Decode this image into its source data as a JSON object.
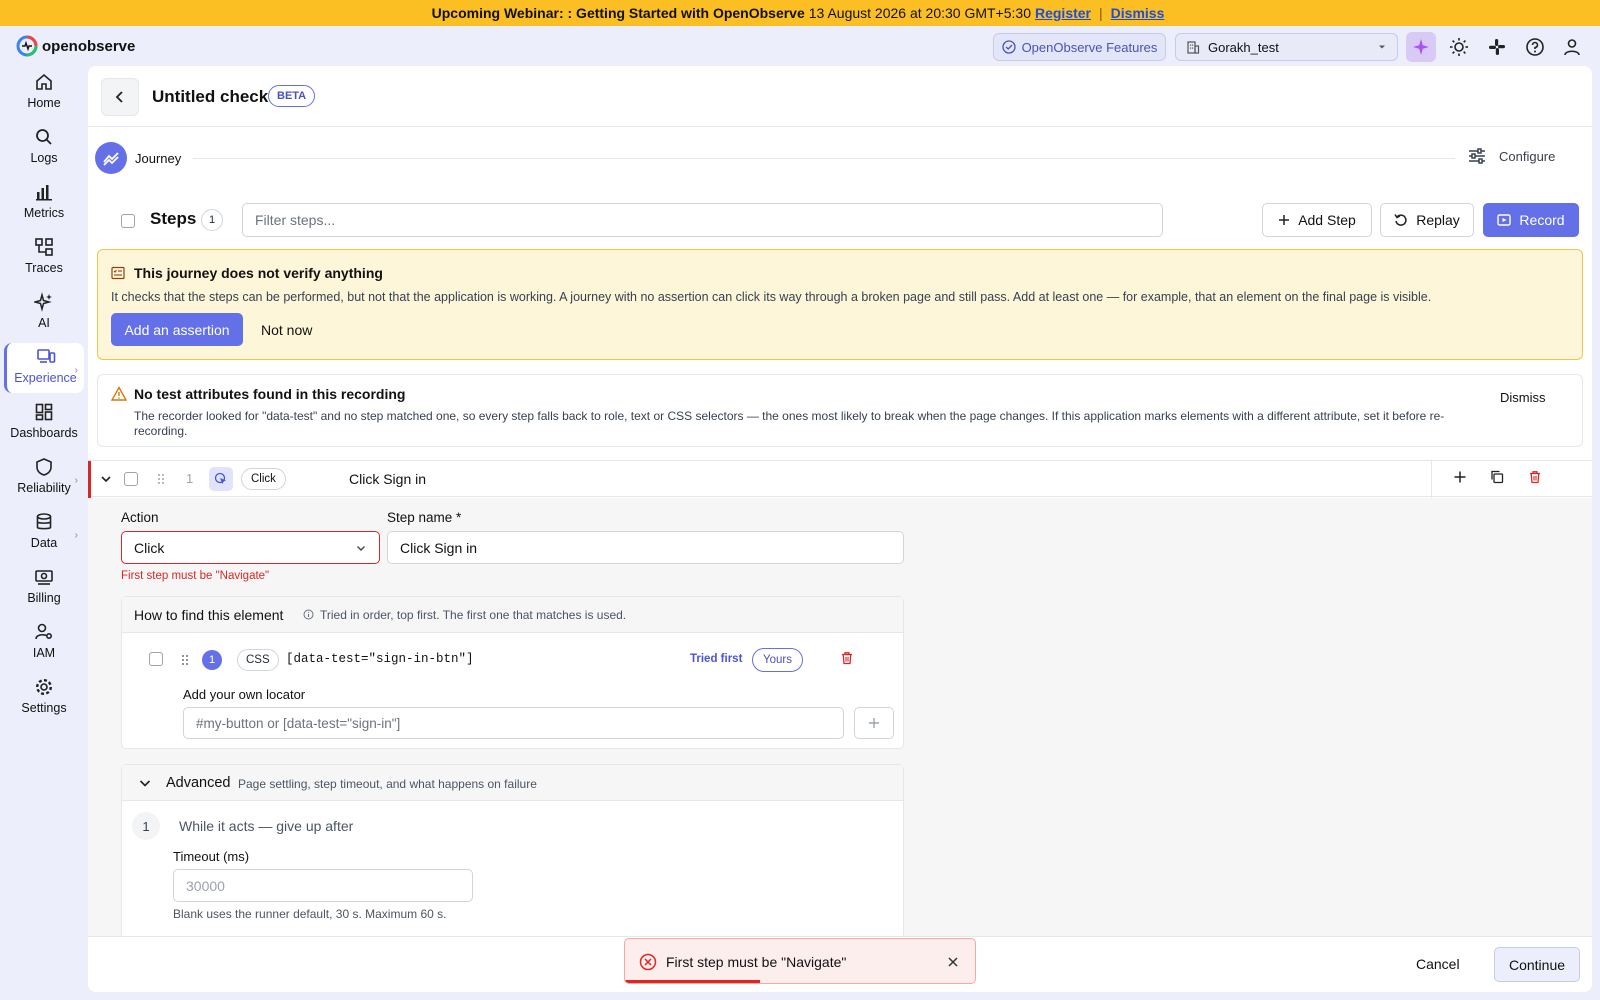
{
  "banner": {
    "title": "Upcoming Webinar: : Getting Started with OpenObserve",
    "datetime": "13 August 2026 at 20:30 GMT+5:30",
    "register": "Register",
    "separator": "|",
    "dismiss": "Dismiss"
  },
  "topbar": {
    "brand": "openobserve",
    "features_label": "OpenObserve Features",
    "org": "Gorakh_test"
  },
  "sidebar": {
    "items": [
      {
        "label": "Home",
        "icon": "home-icon"
      },
      {
        "label": "Logs",
        "icon": "search-icon"
      },
      {
        "label": "Metrics",
        "icon": "bar-chart-icon"
      },
      {
        "label": "Traces",
        "icon": "traces-icon"
      },
      {
        "label": "AI",
        "icon": "sparkle-icon"
      },
      {
        "label": "Experience",
        "icon": "devices-icon"
      },
      {
        "label": "Dashboards",
        "icon": "dashboard-icon"
      },
      {
        "label": "Reliability",
        "icon": "shield-icon"
      },
      {
        "label": "Data",
        "icon": "database-icon"
      },
      {
        "label": "Billing",
        "icon": "billing-icon"
      },
      {
        "label": "IAM",
        "icon": "user-key-icon"
      },
      {
        "label": "Settings",
        "icon": "gear-icon"
      }
    ],
    "active": "Experience"
  },
  "header": {
    "title": "Untitled check",
    "badge": "BETA"
  },
  "journey": {
    "label": "Journey",
    "configure": "Configure"
  },
  "steps_bar": {
    "label": "Steps",
    "count": "1",
    "filter_placeholder": "Filter steps...",
    "add_step": "Add Step",
    "replay": "Replay",
    "record": "Record"
  },
  "assertion_warning": {
    "title": "This journey does not verify anything",
    "text": "It checks that the steps can be performed, but not that the application is working. A journey with no assertion can click its way through a broken page and still pass. Add at least one — for example, that an element on the final page is visible.",
    "add_button": "Add an assertion",
    "later_button": "Not now"
  },
  "attr_warning": {
    "title": "No test attributes found in this recording",
    "text": "The recorder looked for \"data-test\" and no step matched one, so every step falls back to role, text or CSS selectors — the ones most likely to break when the page changes. If this application marks elements with a different attribute, set it before re-recording.",
    "dismiss": "Dismiss"
  },
  "step": {
    "number": "1",
    "type_tag": "Click",
    "name": "Click Sign in",
    "action_label": "Action",
    "action_value": "Click",
    "action_error": "First step must be \"Navigate\"",
    "stepname_label": "Step name *",
    "stepname_value": "Click Sign in"
  },
  "locator": {
    "title": "How to find this element",
    "subtitle": "Tried in order, top first. The first one that matches is used.",
    "rows": [
      {
        "num": "1",
        "kind": "CSS",
        "selector": "[data-test=\"sign-in-btn\"]",
        "tried": "Tried first",
        "source": "Yours"
      }
    ],
    "own_label": "Add your own locator",
    "own_placeholder": "#my-button or [data-test=\"sign-in\"]"
  },
  "advanced": {
    "title": "Advanced",
    "subtitle": "Page settling, step timeout, and what happens on failure",
    "section_num": "1",
    "section_title": "While it acts — give up after",
    "timeout_label": "Timeout (ms)",
    "timeout_placeholder": "30000",
    "timeout_help": "Blank uses the runner default, 30 s. Maximum 60 s."
  },
  "footer": {
    "cancel": "Cancel",
    "continue": "Continue"
  },
  "toast": {
    "message": "First step must be \"Navigate\""
  },
  "colors": {
    "accent": "#6470e8",
    "error": "#dc2626",
    "banner": "#fbbf24",
    "warning_bg": "#fdf6d8"
  }
}
